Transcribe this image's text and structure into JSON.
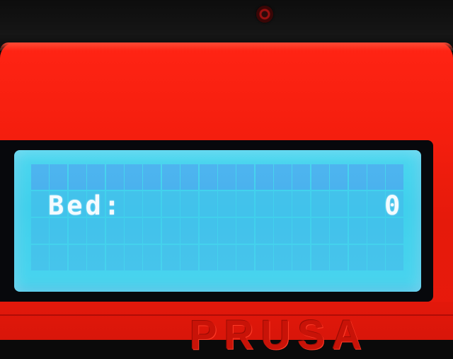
{
  "device": {
    "brand": "PRUSA"
  },
  "lcd": {
    "columns": 20,
    "rows": 4,
    "backlight_color": "#46d3ee",
    "text_color": "#f4fbff",
    "line2": {
      "label": "Bed:",
      "value": "0"
    }
  },
  "colors": {
    "case": "#f51e0e",
    "bezel": "#07080c"
  }
}
